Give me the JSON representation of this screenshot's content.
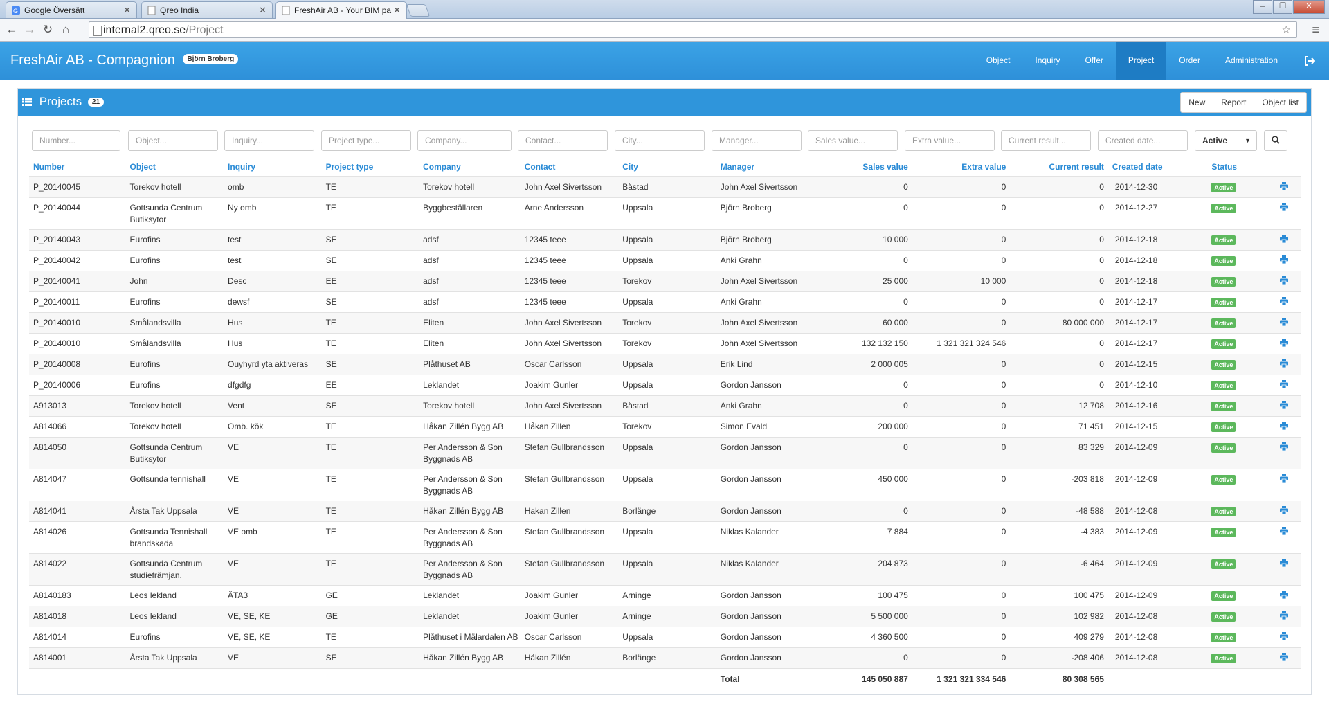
{
  "browser": {
    "tabs": [
      {
        "title": "Google Översätt"
      },
      {
        "title": "Qreo India"
      },
      {
        "title": "FreshAir AB - Your BIM pa"
      }
    ],
    "url_host": "internal2.qreo.se",
    "url_path": "/Project"
  },
  "app": {
    "title": "FreshAir AB - Compagnion",
    "user": "Björn Broberg",
    "nav": [
      "Object",
      "Inquiry",
      "Offer",
      "Project",
      "Order",
      "Administration"
    ],
    "active_nav": "Project"
  },
  "panel": {
    "title": "Projects",
    "count": "21",
    "actions": {
      "new": "New",
      "report": "Report",
      "object_list": "Object list"
    }
  },
  "filters": {
    "number": "Number...",
    "object": "Object...",
    "inquiry": "Inquiry...",
    "project_type": "Project type...",
    "company": "Company...",
    "contact": "Contact...",
    "city": "City...",
    "manager": "Manager...",
    "sales_value": "Sales value...",
    "extra_value": "Extra value...",
    "current_result": "Current result...",
    "created_date": "Created date...",
    "status": "Active"
  },
  "columns": {
    "number": "Number",
    "object": "Object",
    "inquiry": "Inquiry",
    "project_type": "Project type",
    "company": "Company",
    "contact": "Contact",
    "city": "City",
    "manager": "Manager",
    "sales_value": "Sales value",
    "extra_value": "Extra value",
    "current_result": "Current result",
    "created_date": "Created date",
    "status": "Status"
  },
  "rows": [
    {
      "number": "P_20140045",
      "object": "Torekov hotell",
      "inquiry": "omb",
      "type": "TE",
      "company": "Torekov hotell",
      "contact": "John Axel Sivertsson",
      "city": "Båstad",
      "manager": "John Axel Sivertsson",
      "sales": "0",
      "extra": "0",
      "result": "0",
      "date": "2014-12-30",
      "status": "Active"
    },
    {
      "number": "P_20140044",
      "object": "Gottsunda Centrum Butiksytor",
      "inquiry": "Ny omb",
      "type": "TE",
      "company": "Byggbeställaren",
      "contact": "Arne Andersson",
      "city": "Uppsala",
      "manager": "Björn Broberg",
      "sales": "0",
      "extra": "0",
      "result": "0",
      "date": "2014-12-27",
      "status": "Active"
    },
    {
      "number": "P_20140043",
      "object": "Eurofins",
      "inquiry": "test",
      "type": "SE",
      "company": "adsf",
      "contact": "12345 teee",
      "city": "Uppsala",
      "manager": "Björn Broberg",
      "sales": "10 000",
      "extra": "0",
      "result": "0",
      "date": "2014-12-18",
      "status": "Active"
    },
    {
      "number": "P_20140042",
      "object": "Eurofins",
      "inquiry": "test",
      "type": "SE",
      "company": "adsf",
      "contact": "12345 teee",
      "city": "Uppsala",
      "manager": "Anki Grahn",
      "sales": "0",
      "extra": "0",
      "result": "0",
      "date": "2014-12-18",
      "status": "Active"
    },
    {
      "number": "P_20140041",
      "object": "John",
      "inquiry": "Desc",
      "type": "EE",
      "company": "adsf",
      "contact": "12345 teee",
      "city": "Torekov",
      "manager": "John Axel Sivertsson",
      "sales": "25 000",
      "extra": "10 000",
      "result": "0",
      "date": "2014-12-18",
      "status": "Active"
    },
    {
      "number": "P_20140011",
      "object": "Eurofins",
      "inquiry": "dewsf",
      "type": "SE",
      "company": "adsf",
      "contact": "12345 teee",
      "city": "Uppsala",
      "manager": "Anki Grahn",
      "sales": "0",
      "extra": "0",
      "result": "0",
      "date": "2014-12-17",
      "status": "Active"
    },
    {
      "number": "P_20140010",
      "object": "Smålandsvilla",
      "inquiry": "Hus",
      "type": "TE",
      "company": "Eliten",
      "contact": "John Axel Sivertsson",
      "city": "Torekov",
      "manager": "John Axel Sivertsson",
      "sales": "60 000",
      "extra": "0",
      "result": "80 000 000",
      "date": "2014-12-17",
      "status": "Active"
    },
    {
      "number": "P_20140010",
      "object": "Smålandsvilla",
      "inquiry": "Hus",
      "type": "TE",
      "company": "Eliten",
      "contact": "John Axel Sivertsson",
      "city": "Torekov",
      "manager": "John Axel Sivertsson",
      "sales": "132 132 150",
      "extra": "1 321 321 324 546",
      "result": "0",
      "date": "2014-12-17",
      "status": "Active"
    },
    {
      "number": "P_20140008",
      "object": "Eurofins",
      "inquiry": "Ouyhyrd yta aktiveras",
      "type": "SE",
      "company": "Plåthuset AB",
      "contact": "Oscar Carlsson",
      "city": "Uppsala",
      "manager": "Erik Lind",
      "sales": "2 000 005",
      "extra": "0",
      "result": "0",
      "date": "2014-12-15",
      "status": "Active"
    },
    {
      "number": "P_20140006",
      "object": "Eurofins",
      "inquiry": "dfgdfg",
      "type": "EE",
      "company": "Leklandet",
      "contact": "Joakim Gunler",
      "city": "Uppsala",
      "manager": "Gordon Jansson",
      "sales": "0",
      "extra": "0",
      "result": "0",
      "date": "2014-12-10",
      "status": "Active"
    },
    {
      "number": "A913013",
      "object": "Torekov hotell",
      "inquiry": "Vent",
      "type": "SE",
      "company": "Torekov hotell",
      "contact": "John Axel Sivertsson",
      "city": "Båstad",
      "manager": "Anki Grahn",
      "sales": "0",
      "extra": "0",
      "result": "12 708",
      "date": "2014-12-16",
      "status": "Active"
    },
    {
      "number": "A814066",
      "object": "Torekov hotell",
      "inquiry": "Omb. kök",
      "type": "TE",
      "company": "Håkan Zillén Bygg AB",
      "contact": "Håkan Zillen",
      "city": "Torekov",
      "manager": "Simon Evald",
      "sales": "200 000",
      "extra": "0",
      "result": "71 451",
      "date": "2014-12-15",
      "status": "Active"
    },
    {
      "number": "A814050",
      "object": "Gottsunda Centrum Butiksytor",
      "inquiry": "VE",
      "type": "TE",
      "company": "Per Andersson & Son Byggnads AB",
      "contact": "Stefan Gullbrandsson",
      "city": "Uppsala",
      "manager": "Gordon Jansson",
      "sales": "0",
      "extra": "0",
      "result": "83 329",
      "date": "2014-12-09",
      "status": "Active"
    },
    {
      "number": "A814047",
      "object": "Gottsunda tennishall",
      "inquiry": "VE",
      "type": "TE",
      "company": "Per Andersson & Son Byggnads AB",
      "contact": "Stefan Gullbrandsson",
      "city": "Uppsala",
      "manager": "Gordon Jansson",
      "sales": "450 000",
      "extra": "0",
      "result": "-203 818",
      "date": "2014-12-09",
      "status": "Active"
    },
    {
      "number": "A814041",
      "object": "Årsta Tak Uppsala",
      "inquiry": "VE",
      "type": "TE",
      "company": "Håkan Zillén Bygg AB",
      "contact": "Hakan Zillen",
      "city": "Borlänge",
      "manager": "Gordon Jansson",
      "sales": "0",
      "extra": "0",
      "result": "-48 588",
      "date": "2014-12-08",
      "status": "Active"
    },
    {
      "number": "A814026",
      "object": "Gottsunda Tennishall brandskada",
      "inquiry": "VE omb",
      "type": "TE",
      "company": "Per Andersson & Son Byggnads AB",
      "contact": "Stefan Gullbrandsson",
      "city": "Uppsala",
      "manager": "Niklas Kalander",
      "sales": "7 884",
      "extra": "0",
      "result": "-4 383",
      "date": "2014-12-09",
      "status": "Active"
    },
    {
      "number": "A814022",
      "object": "Gottsunda Centrum studiefrämjan.",
      "inquiry": "VE",
      "type": "TE",
      "company": "Per Andersson & Son Byggnads AB",
      "contact": "Stefan Gullbrandsson",
      "city": "Uppsala",
      "manager": "Niklas Kalander",
      "sales": "204 873",
      "extra": "0",
      "result": "-6 464",
      "date": "2014-12-09",
      "status": "Active"
    },
    {
      "number": "A8140183",
      "object": "Leos lekland",
      "inquiry": "ÄTA3",
      "type": "GE",
      "company": "Leklandet",
      "contact": "Joakim Gunler",
      "city": "Arninge",
      "manager": "Gordon Jansson",
      "sales": "100 475",
      "extra": "0",
      "result": "100 475",
      "date": "2014-12-09",
      "status": "Active"
    },
    {
      "number": "A814018",
      "object": "Leos lekland",
      "inquiry": "VE, SE, KE",
      "type": "GE",
      "company": "Leklandet",
      "contact": "Joakim Gunler",
      "city": "Arninge",
      "manager": "Gordon Jansson",
      "sales": "5 500 000",
      "extra": "0",
      "result": "102 982",
      "date": "2014-12-08",
      "status": "Active"
    },
    {
      "number": "A814014",
      "object": "Eurofins",
      "inquiry": "VE, SE, KE",
      "type": "TE",
      "company": "Plåthuset i Mälardalen AB",
      "contact": "Oscar Carlsson",
      "city": "Uppsala",
      "manager": "Gordon Jansson",
      "sales": "4 360 500",
      "extra": "0",
      "result": "409 279",
      "date": "2014-12-08",
      "status": "Active"
    },
    {
      "number": "A814001",
      "object": "Årsta Tak Uppsala",
      "inquiry": "VE",
      "type": "SE",
      "company": "Håkan Zillén Bygg AB",
      "contact": "Håkan Zillén",
      "city": "Borlänge",
      "manager": "Gordon Jansson",
      "sales": "0",
      "extra": "0",
      "result": "-208 406",
      "date": "2014-12-08",
      "status": "Active"
    }
  ],
  "totals": {
    "label": "Total",
    "sales": "145 050 887",
    "extra": "1 321 321 334 546",
    "result": "80 308 565"
  },
  "colors": {
    "header_blue": "#2f95db",
    "nav_active": "#1e7cc4",
    "link_blue": "#2a8bd6",
    "status_green": "#5cb85c"
  },
  "icons": {
    "print": "print-icon",
    "search": "search-icon",
    "list": "list-icon",
    "logout": "logout-icon"
  }
}
